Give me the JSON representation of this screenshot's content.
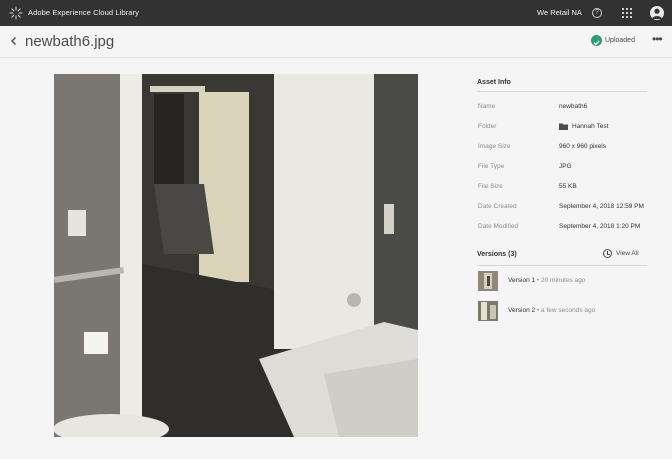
{
  "topbar": {
    "app_title": "Adobe Experience Cloud Library",
    "org_name": "We Retail NA",
    "help_glyph": "?"
  },
  "header": {
    "title": "newbath6.jpg",
    "status": "Uploaded",
    "more_glyph": "•••"
  },
  "asset_info": {
    "heading": "Asset Info",
    "rows": [
      {
        "label": "Name",
        "value": "newbath6"
      },
      {
        "label": "Folder",
        "value": "Hannah Test"
      },
      {
        "label": "Image Size",
        "value": "960 x 960 pixels"
      },
      {
        "label": "File Type",
        "value": "JPG"
      },
      {
        "label": "File Size",
        "value": "55 KB"
      },
      {
        "label": "Date Created",
        "value": "September 4, 2018 12:59 PM"
      },
      {
        "label": "Date Modified",
        "value": "September 4, 2018 1:20 PM"
      }
    ]
  },
  "versions": {
    "heading": "Versions (3)",
    "view_all": "View All",
    "items": [
      {
        "name": "Version 1",
        "time": "20 minutes ago"
      },
      {
        "name": "Version 2",
        "time": "a few seconds ago"
      }
    ]
  },
  "icons": [
    "adobe-logo-icon",
    "help-icon",
    "apps-grid-icon",
    "avatar-icon",
    "back-icon",
    "check-circle-icon",
    "more-icon",
    "folder-icon",
    "clock-icon"
  ],
  "colors": {
    "topbar": "#323232",
    "accent_success": "#2d9d78",
    "background": "#f5f5f5"
  }
}
